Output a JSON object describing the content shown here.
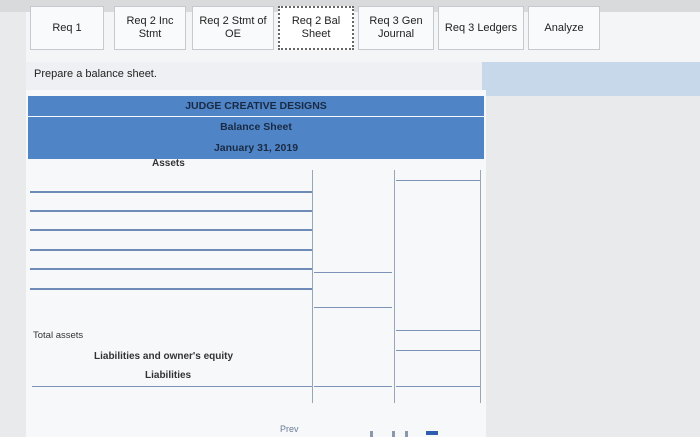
{
  "tabs": [
    {
      "label": "Req 1"
    },
    {
      "label": "Req 2 Inc Stmt"
    },
    {
      "label": "Req 2 Stmt of OE"
    },
    {
      "label": "Req 2 Bal Sheet"
    },
    {
      "label": "Req 3 Gen Journal"
    },
    {
      "label": "Req 3 Ledgers"
    },
    {
      "label": "Analyze"
    }
  ],
  "instruction": "Prepare a balance sheet.",
  "sheet": {
    "company": "JUDGE CREATIVE DESIGNS",
    "title": "Balance Sheet",
    "date": "January 31, 2019",
    "assets_label": "Assets",
    "total_assets_label": "Total assets",
    "liab_owner_label": "Liabilities and owner's equity",
    "liabilities_label": "Liabilities"
  },
  "bottom": {
    "prev_label": "Prev"
  },
  "colors": {
    "header_blue": "#4f85c6",
    "accent_blue": "#2f5eb1"
  }
}
